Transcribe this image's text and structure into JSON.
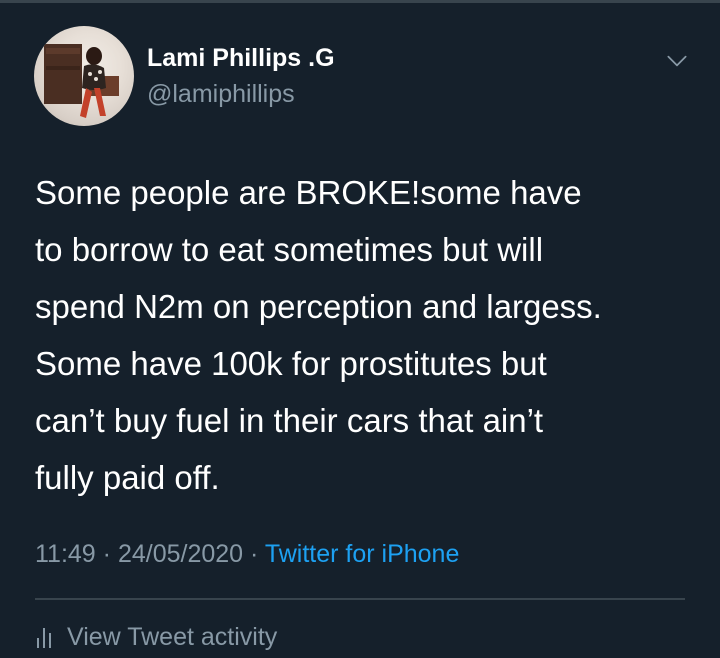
{
  "user": {
    "display_name": "Lami Phillips .G",
    "handle": "@lamiphillips"
  },
  "tweet": {
    "lines": [
      "Some people are BROKE!some have",
      "to borrow to eat sometimes but will",
      "spend N2m on perception and largess.",
      "Some have 100k for prostitutes but",
      "can’t buy fuel in their cars that ain’t",
      "fully paid off."
    ]
  },
  "meta": {
    "time": "11:49",
    "separator": " · ",
    "date": "24/05/2020",
    "source": "Twitter for iPhone"
  },
  "actions": {
    "view_activity": "View Tweet activity"
  },
  "icons": {
    "menu": "chevron-down-icon",
    "activity": "bar-chart-icon"
  },
  "colors": {
    "background": "#15202b",
    "primary_text": "#ffffff",
    "secondary_text": "#8899a6",
    "link": "#1da1f2",
    "divider": "#38444d"
  }
}
